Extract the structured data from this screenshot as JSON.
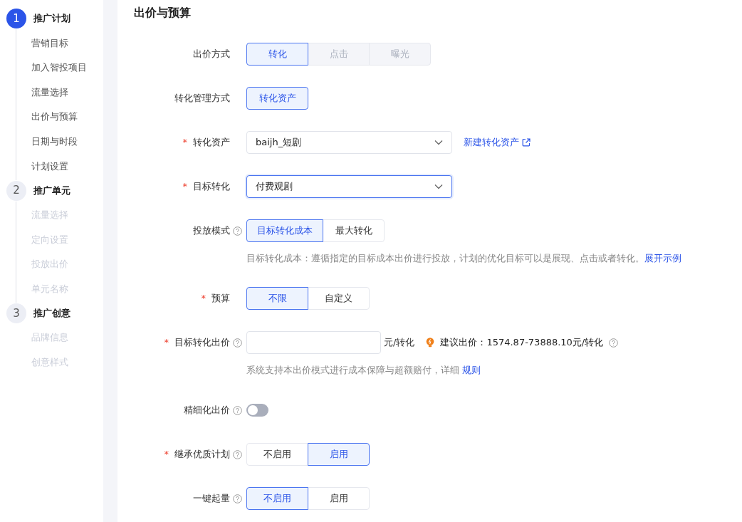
{
  "sidebar": {
    "steps": [
      {
        "number": "1",
        "title": "推广计划",
        "active": true,
        "items": [
          {
            "label": "营销目标",
            "disabled": false
          },
          {
            "label": "加入智投项目",
            "disabled": false
          },
          {
            "label": "流量选择",
            "disabled": false
          },
          {
            "label": "出价与预算",
            "disabled": false
          },
          {
            "label": "日期与时段",
            "disabled": false
          },
          {
            "label": "计划设置",
            "disabled": false
          }
        ]
      },
      {
        "number": "2",
        "title": "推广单元",
        "active": false,
        "items": [
          {
            "label": "流量选择",
            "disabled": true
          },
          {
            "label": "定向设置",
            "disabled": true
          },
          {
            "label": "投放出价",
            "disabled": true
          },
          {
            "label": "单元名称",
            "disabled": true
          }
        ]
      },
      {
        "number": "3",
        "title": "推广创意",
        "active": false,
        "items": [
          {
            "label": "品牌信息",
            "disabled": true
          },
          {
            "label": "创意样式",
            "disabled": true
          }
        ]
      }
    ]
  },
  "section": {
    "title": "出价与预算",
    "rows": [
      {
        "kind": "segmented",
        "label": "出价方式",
        "help": false,
        "options": [
          {
            "label": "转化",
            "selected": true,
            "disabled": false
          },
          {
            "label": "点击",
            "selected": false,
            "disabled": true
          },
          {
            "label": "曝光",
            "selected": false,
            "disabled": true
          }
        ]
      },
      {
        "kind": "segmented",
        "label": "转化管理方式",
        "help": false,
        "options": [
          {
            "label": "转化资产",
            "selected": true,
            "disabled": false
          }
        ]
      },
      {
        "kind": "select",
        "label": "转化资产",
        "required_mark": "*",
        "help": false,
        "value": "baijh_短剧",
        "focused": false,
        "link": "新建转化资产"
      },
      {
        "kind": "select",
        "label": "目标转化",
        "required_mark": "*",
        "help": false,
        "value": "付费观剧",
        "focused": true
      },
      {
        "kind": "segmented",
        "label": "投放模式",
        "help": true,
        "options": [
          {
            "label": "目标转化成本",
            "selected": true,
            "disabled": false
          },
          {
            "label": "最大转化",
            "selected": false,
            "disabled": false
          }
        ],
        "hint": {
          "text": "目标转化成本：遵循指定的目标成本出价进行投放，计划的优化目标可以是展现、点击或者转化。",
          "link": "展开示例"
        }
      },
      {
        "kind": "segmented",
        "label": "预算",
        "required_mark": "*",
        "help": false,
        "options": [
          {
            "label": "不限",
            "selected": true,
            "disabled": false
          },
          {
            "label": "自定义",
            "selected": false,
            "disabled": false
          }
        ]
      },
      {
        "kind": "input",
        "label": "目标转化出价",
        "required_mark": "*",
        "help": true,
        "suffix": "元/转化",
        "suggestion": "建议出价：1574.87-73888.10元/转化",
        "hint": {
          "text": "系统支持本出价模式进行成本保障与超额赔付，详细 ",
          "link": "规则"
        }
      },
      {
        "kind": "toggle",
        "label": "精细化出价",
        "help": true,
        "on": false
      },
      {
        "kind": "segmented",
        "label": "继承优质计划",
        "required_mark": "*",
        "help": true,
        "options": [
          {
            "label": "不启用",
            "selected": false,
            "disabled": false
          },
          {
            "label": "启用",
            "selected": true,
            "disabled": false
          }
        ]
      },
      {
        "kind": "segmented",
        "label": "一键起量",
        "help": true,
        "options": [
          {
            "label": "不启用",
            "selected": true,
            "disabled": false
          },
          {
            "label": "启用",
            "selected": false,
            "disabled": false
          }
        ]
      }
    ]
  }
}
